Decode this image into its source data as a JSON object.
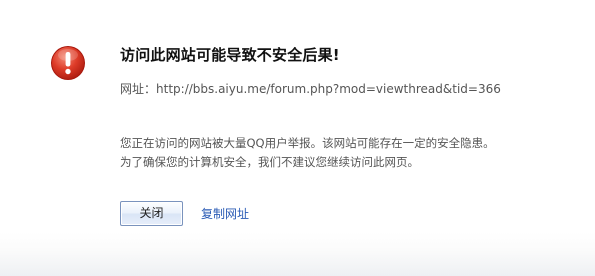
{
  "warning": {
    "icon": "error-exclamation-icon",
    "icon_color": "#d9382a",
    "title": "访问此网站可能导致不安全后果!",
    "url_label": "网址：",
    "url": "http://bbs.aiyu.me/forum.php?mod=viewthread&tid=366",
    "message_line1": "您正在访问的网站被大量QQ用户举报。该网站可能存在一定的安全隐患。",
    "message_line2": "为了确保您的计算机安全，我们不建议您继续访问此网页。"
  },
  "actions": {
    "close_label": "关闭",
    "copy_url_label": "复制网址",
    "link_color": "#2a5bb5"
  }
}
